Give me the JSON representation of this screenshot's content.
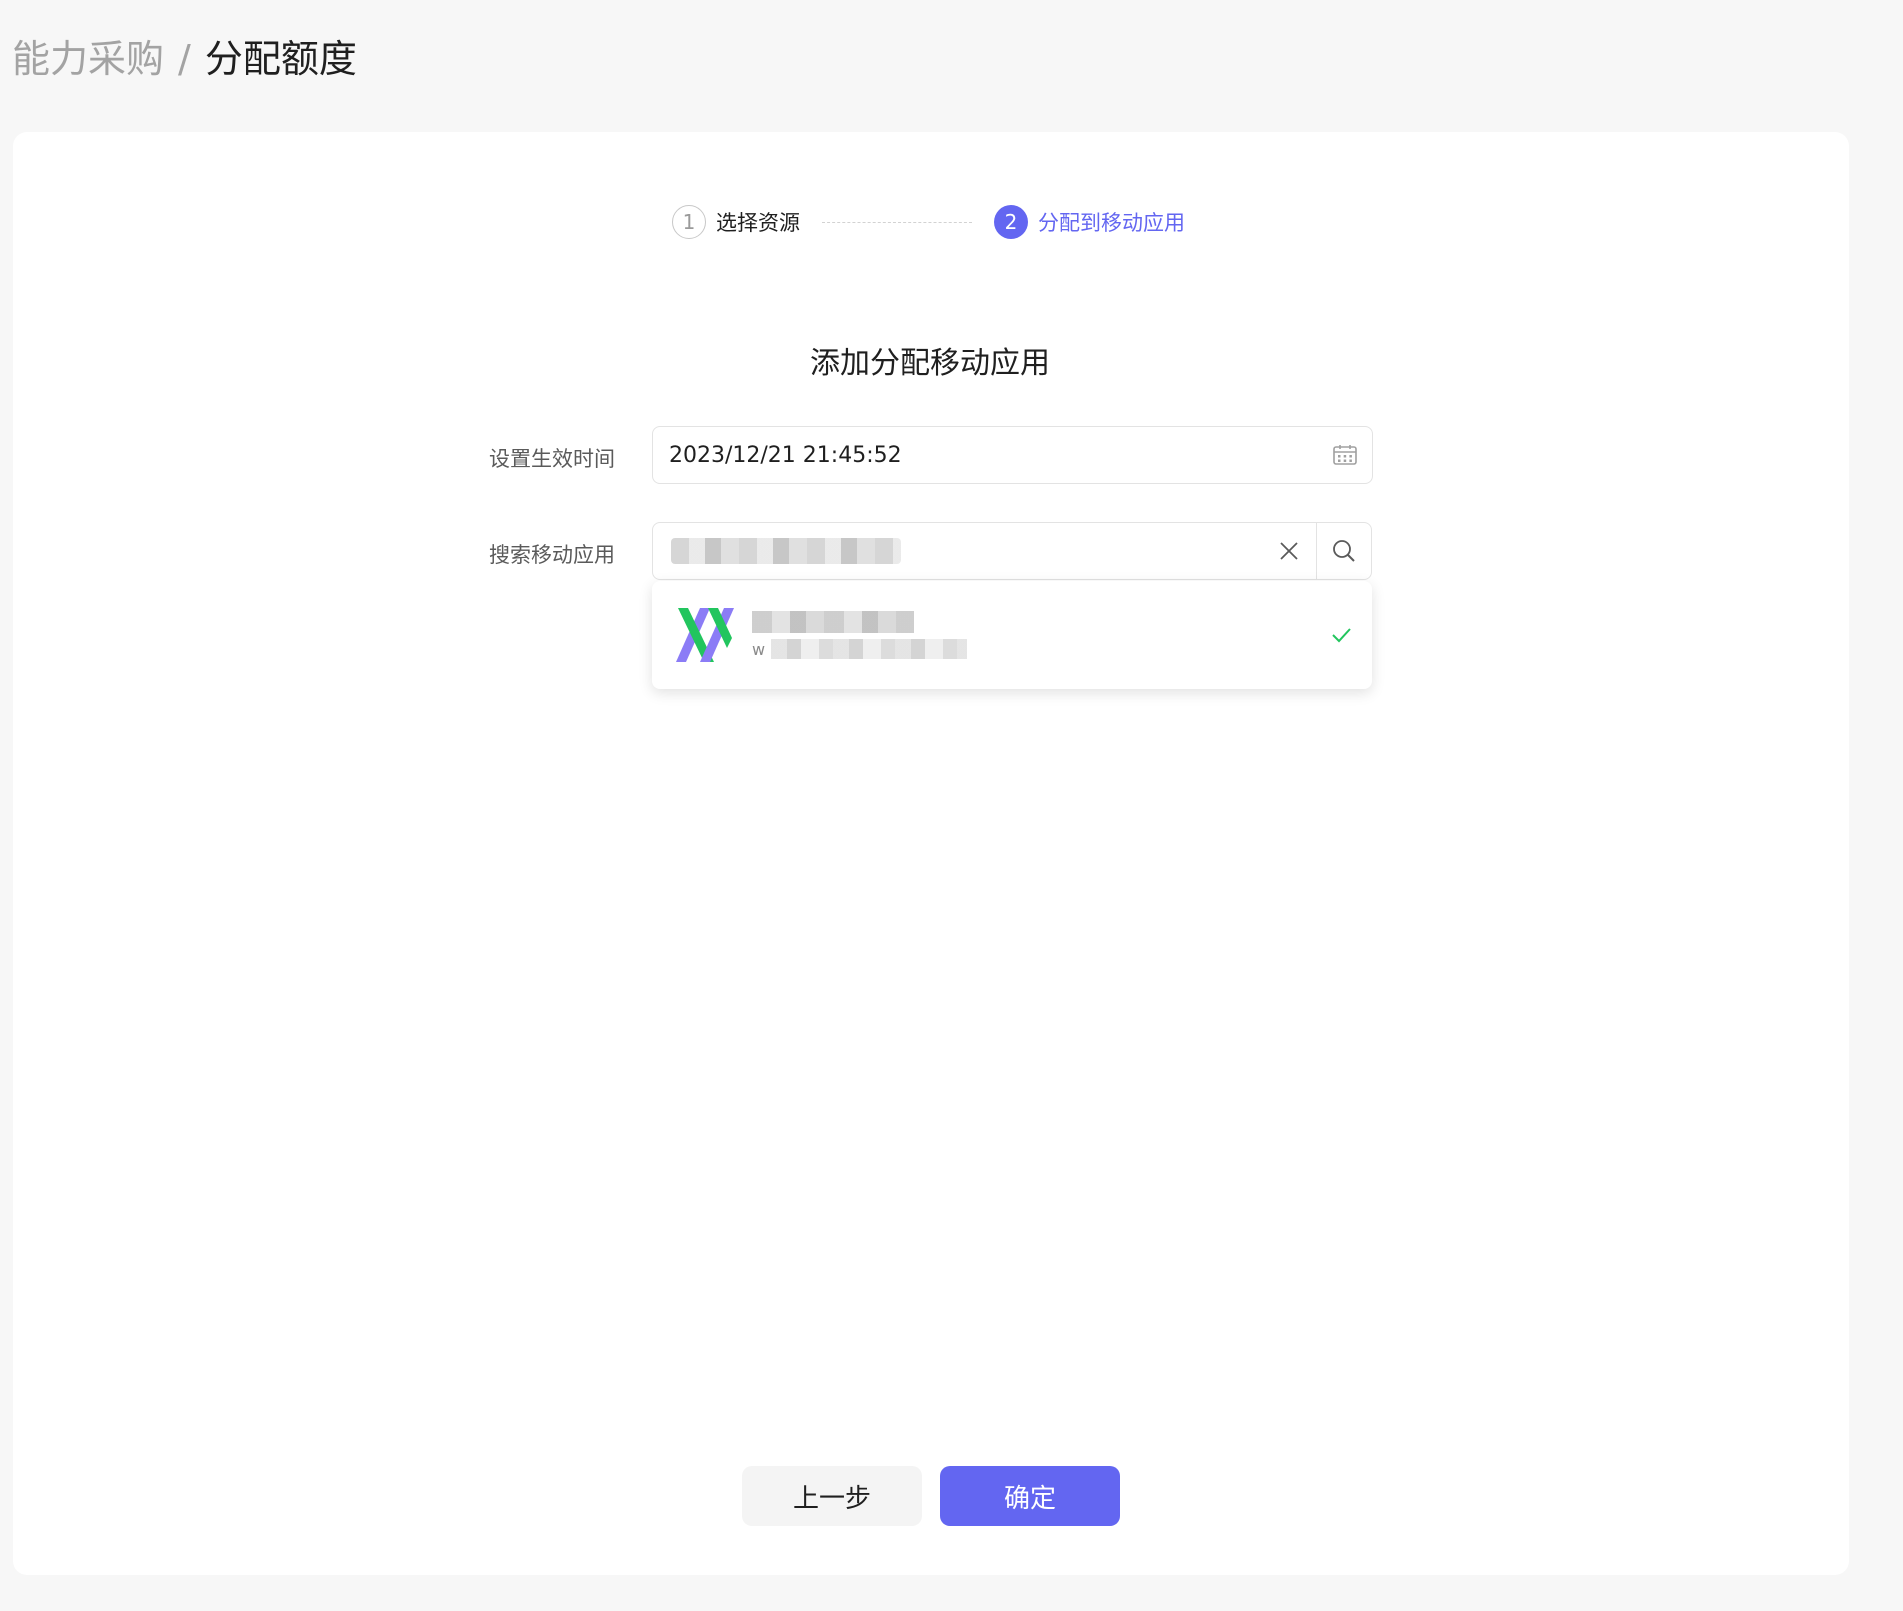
{
  "breadcrumb": {
    "parent": "能力采购",
    "separator": "/",
    "current": "分配额度"
  },
  "steps": [
    {
      "number": "1",
      "label": "选择资源",
      "status": "done"
    },
    {
      "number": "2",
      "label": "分配到移动应用",
      "status": "active"
    }
  ],
  "section_title": "添加分配移动应用",
  "form": {
    "effective_time": {
      "label": "设置生效时间",
      "value": "2023/12/21 21:45:52",
      "icon": "calendar-icon"
    },
    "search_app": {
      "label": "搜索移动应用",
      "icon_clear": "close-icon",
      "icon_search": "search-icon"
    }
  },
  "search_result": {
    "package_initial": "w",
    "selected": true,
    "icon": "check-icon"
  },
  "buttons": {
    "prev": "上一步",
    "confirm": "确定"
  },
  "colors": {
    "accent": "#6366f1",
    "success": "#22c55e",
    "background": "#f7f7f7"
  }
}
